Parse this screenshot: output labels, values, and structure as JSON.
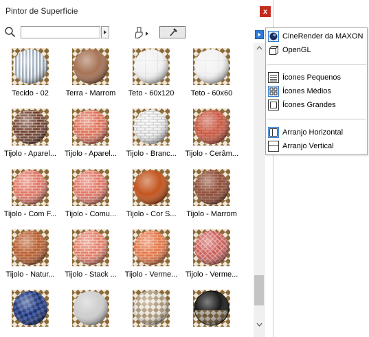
{
  "window": {
    "title": "Pintor de Superfície",
    "close_label": "x"
  },
  "search": {
    "value": "",
    "placeholder": ""
  },
  "materials": [
    {
      "label": "Tecido - 02",
      "swatch": "stripes",
      "c1": "#9aa9b8",
      "c2": "#f4f6f8"
    },
    {
      "label": "Terra - Marrom",
      "swatch": "solid",
      "c1": "#a77356",
      "c2": "#7c4f37"
    },
    {
      "label": "Teto - 60x120",
      "swatch": "tile",
      "c1": "#f2f2f2",
      "c2": "#cfcfcf"
    },
    {
      "label": "Teto - 60x60",
      "swatch": "tile",
      "c1": "#f3f3f3",
      "c2": "#d4d4d4"
    },
    {
      "label": "Tijolo - Aparel...",
      "swatch": "brick",
      "c1": "#6e3b2d",
      "c2": "#c9b9a8"
    },
    {
      "label": "Tijolo - Aparel...",
      "swatch": "brick",
      "c1": "#df6b55",
      "c2": "#f2c6b4"
    },
    {
      "label": "Tijolo - Branc...",
      "swatch": "brick",
      "c1": "#f4f4f4",
      "c2": "#bdbdbd"
    },
    {
      "label": "Tijolo - Cerâm...",
      "swatch": "brick",
      "c1": "#d9705a",
      "c2": "#b24d3b"
    },
    {
      "label": "Tijolo - Com F...",
      "swatch": "brick",
      "c1": "#df7161",
      "c2": "#f3c2b5"
    },
    {
      "label": "Tijolo - Comu...",
      "swatch": "brick",
      "c1": "#e27263",
      "c2": "#f4c6b8"
    },
    {
      "label": "Tijolo - Cor S...",
      "swatch": "solid",
      "c1": "#c3551f",
      "c2": "#8f3512"
    },
    {
      "label": "Tijolo - Marrom",
      "swatch": "brick",
      "c1": "#8a4a36",
      "c2": "#b7806a"
    },
    {
      "label": "Tijolo - Natur...",
      "swatch": "brick",
      "c1": "#b55a33",
      "c2": "#d79a6a"
    },
    {
      "label": "Tijolo - Stack ...",
      "swatch": "brick",
      "c1": "#e57a64",
      "c2": "#f5cfc2"
    },
    {
      "label": "Tijolo - Verme...",
      "swatch": "brick",
      "c1": "#e27347",
      "c2": "#f3b996"
    },
    {
      "label": "Tijolo - Verme...",
      "swatch": "herring",
      "c1": "#c95d5a",
      "c2": "#e8a8a2"
    },
    {
      "label": "",
      "swatch": "check",
      "c1": "#3b5aa8",
      "c2": "#1f2f66"
    },
    {
      "label": "",
      "swatch": "solid",
      "c1": "#cfcfcf",
      "c2": "#9f9f9f"
    },
    {
      "label": "",
      "swatch": "glass",
      "c1": "#e8e8e8",
      "c2": "#bdbdbd"
    },
    {
      "label": "",
      "swatch": "black",
      "c1": "#1a1a1a",
      "c2": "#000000"
    }
  ],
  "menu": {
    "items": [
      {
        "label": "CineRender da MAXON",
        "icon": "cinerender-icon",
        "checked": true
      },
      {
        "label": "OpenGL",
        "icon": "opengl-icon",
        "checked": false
      },
      {
        "label": "Ícones Pequenos",
        "icon": "small-icons-icon",
        "checked": false
      },
      {
        "label": "Ícones Médios",
        "icon": "medium-icons-icon",
        "checked": true
      },
      {
        "label": "Ícones Grandes",
        "icon": "large-icons-icon",
        "checked": false
      },
      {
        "label": "Arranjo Horizontal",
        "icon": "horizontal-arrangement-icon",
        "checked": true
      },
      {
        "label": "Arranjo Vertical",
        "icon": "vertical-arrangement-icon",
        "checked": false
      }
    ]
  },
  "colors": {
    "accent": "#2e7bd6",
    "close": "#c42b1c",
    "checker_dark": "#8b6a3b",
    "checker_light": "#efe6d6"
  }
}
